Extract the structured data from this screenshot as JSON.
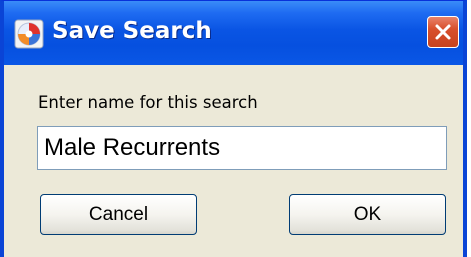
{
  "dialog": {
    "title": "Save Search",
    "icon": "save-search-app-icon",
    "close_icon": "close-icon"
  },
  "form": {
    "prompt": "Enter name for this search",
    "name_value": "Male Recurrents"
  },
  "buttons": {
    "cancel_label": "Cancel",
    "ok_label": "OK"
  },
  "colors": {
    "titlebar": "#0a55e4",
    "dialog_bg": "#ece9d8",
    "close_button": "#d8502c",
    "button_border": "#003c74"
  }
}
